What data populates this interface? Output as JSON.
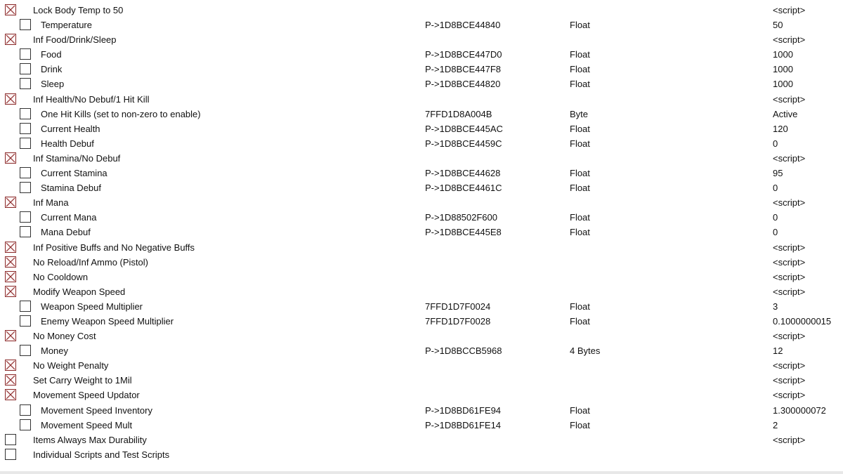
{
  "colors": {
    "checked_box": "#8a2a2a"
  },
  "rows": [
    {
      "level": 0,
      "checked": true,
      "desc": "Lock Body Temp to 50",
      "address": "",
      "type": "",
      "value": "<script>"
    },
    {
      "level": 1,
      "checked": false,
      "desc": "Temperature",
      "address": "P->1D8BCE44840",
      "type": "Float",
      "value": "50"
    },
    {
      "level": 0,
      "checked": true,
      "desc": "Inf Food/Drink/Sleep",
      "address": "",
      "type": "",
      "value": "<script>"
    },
    {
      "level": 1,
      "checked": false,
      "desc": "Food",
      "address": "P->1D8BCE447D0",
      "type": "Float",
      "value": "1000"
    },
    {
      "level": 1,
      "checked": false,
      "desc": "Drink",
      "address": "P->1D8BCE447F8",
      "type": "Float",
      "value": "1000"
    },
    {
      "level": 1,
      "checked": false,
      "desc": "Sleep",
      "address": "P->1D8BCE44820",
      "type": "Float",
      "value": "1000"
    },
    {
      "level": 0,
      "checked": true,
      "desc": "Inf Health/No Debuf/1 Hit Kill",
      "address": "",
      "type": "",
      "value": "<script>"
    },
    {
      "level": 1,
      "checked": false,
      "desc": "One Hit Kills (set to non-zero to enable)",
      "address": "7FFD1D8A004B",
      "type": "Byte",
      "value": "Active"
    },
    {
      "level": 1,
      "checked": false,
      "desc": "Current Health",
      "address": "P->1D8BCE445AC",
      "type": "Float",
      "value": "120"
    },
    {
      "level": 1,
      "checked": false,
      "desc": "Health Debuf",
      "address": "P->1D8BCE4459C",
      "type": "Float",
      "value": "0"
    },
    {
      "level": 0,
      "checked": true,
      "desc": "Inf Stamina/No Debuf",
      "address": "",
      "type": "",
      "value": "<script>"
    },
    {
      "level": 1,
      "checked": false,
      "desc": "Current Stamina",
      "address": "P->1D8BCE44628",
      "type": "Float",
      "value": "95"
    },
    {
      "level": 1,
      "checked": false,
      "desc": "Stamina Debuf",
      "address": "P->1D8BCE4461C",
      "type": "Float",
      "value": "0"
    },
    {
      "level": 0,
      "checked": true,
      "desc": "Inf Mana",
      "address": "",
      "type": "",
      "value": "<script>"
    },
    {
      "level": 1,
      "checked": false,
      "desc": "Current Mana",
      "address": "P->1D88502F600",
      "type": "Float",
      "value": "0"
    },
    {
      "level": 1,
      "checked": false,
      "desc": "Mana Debuf",
      "address": "P->1D8BCE445E8",
      "type": "Float",
      "value": "0"
    },
    {
      "level": 0,
      "checked": true,
      "desc": "Inf Positive Buffs and No Negative Buffs",
      "address": "",
      "type": "",
      "value": "<script>"
    },
    {
      "level": 0,
      "checked": true,
      "desc": "No Reload/Inf Ammo (Pistol)",
      "address": "",
      "type": "",
      "value": "<script>"
    },
    {
      "level": 0,
      "checked": true,
      "desc": "No Cooldown",
      "address": "",
      "type": "",
      "value": "<script>"
    },
    {
      "level": 0,
      "checked": true,
      "desc": "Modify Weapon Speed",
      "address": "",
      "type": "",
      "value": "<script>"
    },
    {
      "level": 1,
      "checked": false,
      "desc": "Weapon Speed Multiplier",
      "address": "7FFD1D7F0024",
      "type": "Float",
      "value": "3"
    },
    {
      "level": 1,
      "checked": false,
      "desc": "Enemy Weapon Speed Multiplier",
      "address": "7FFD1D7F0028",
      "type": "Float",
      "value": "0.1000000015"
    },
    {
      "level": 0,
      "checked": true,
      "desc": "No Money Cost",
      "address": "",
      "type": "",
      "value": "<script>"
    },
    {
      "level": 1,
      "checked": false,
      "desc": "Money",
      "address": "P->1D8BCCB5968",
      "type": "4 Bytes",
      "value": "12"
    },
    {
      "level": 0,
      "checked": true,
      "desc": "No Weight Penalty",
      "address": "",
      "type": "",
      "value": "<script>"
    },
    {
      "level": 0,
      "checked": true,
      "desc": "Set Carry Weight to 1Mil",
      "address": "",
      "type": "",
      "value": "<script>"
    },
    {
      "level": 0,
      "checked": true,
      "desc": "Movement Speed Updator",
      "address": "",
      "type": "",
      "value": "<script>"
    },
    {
      "level": 1,
      "checked": false,
      "desc": "Movement Speed Inventory",
      "address": "P->1D8BD61FE94",
      "type": "Float",
      "value": "1.300000072"
    },
    {
      "level": 1,
      "checked": false,
      "desc": "Movement Speed Mult",
      "address": "P->1D8BD61FE14",
      "type": "Float",
      "value": "2"
    },
    {
      "level": 0,
      "checked": false,
      "desc": "Items Always Max Durability",
      "address": "",
      "type": "",
      "value": "<script>"
    },
    {
      "level": 0,
      "checked": false,
      "desc": "Individual Scripts and Test Scripts",
      "address": "",
      "type": "",
      "value": ""
    }
  ]
}
